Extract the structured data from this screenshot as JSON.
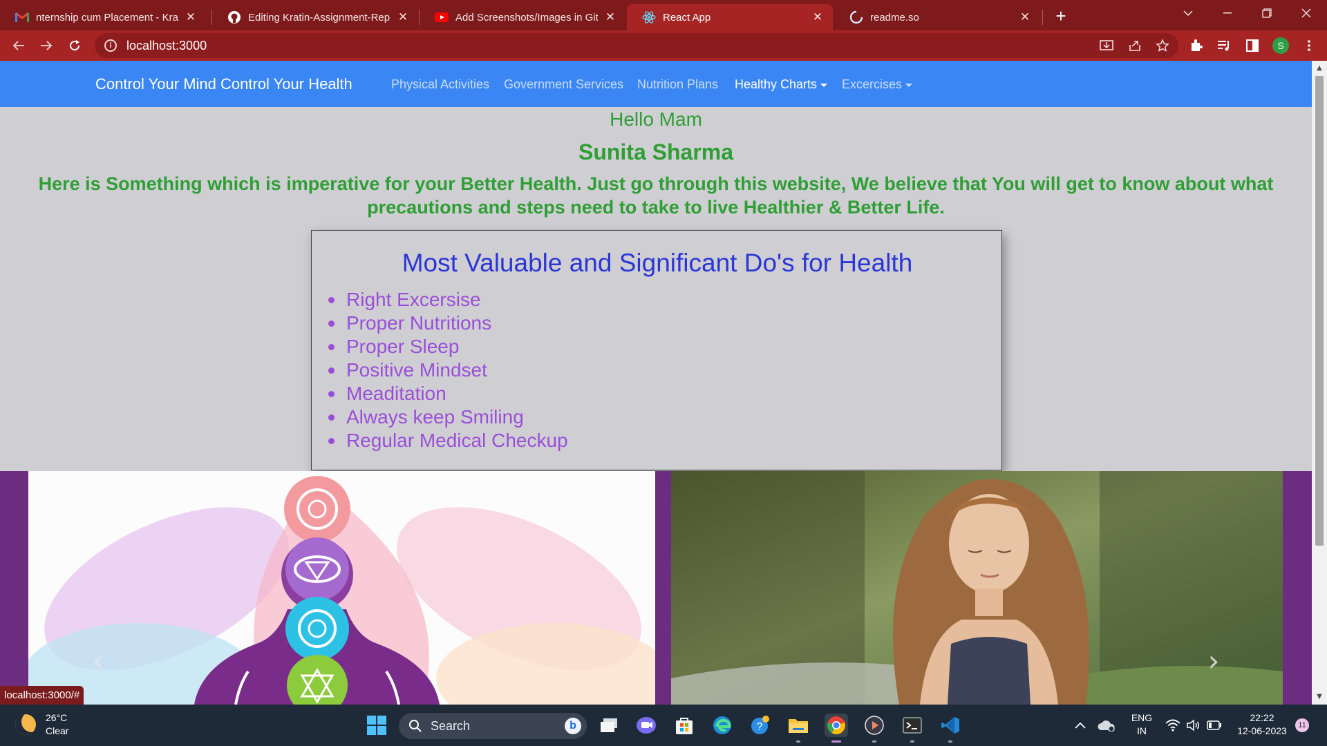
{
  "browser": {
    "tabs": [
      {
        "title": "nternship cum Placement - Kratin",
        "icon": "gmail-icon"
      },
      {
        "title": "Editing Kratin-Assignment-Repo/",
        "icon": "github-icon"
      },
      {
        "title": "Add Screenshots/Images in Githu",
        "icon": "youtube-icon"
      },
      {
        "title": "React App",
        "icon": "react-icon",
        "active": true
      },
      {
        "title": "readme.so",
        "icon": "loading-icon"
      }
    ],
    "url": "localhost:3000",
    "profile_initial": "S",
    "status_url": "localhost:3000/#"
  },
  "navbar": {
    "brand": "Control Your Mind Control Your Health",
    "links": {
      "physical": "Physical Activities",
      "government": "Government Services",
      "nutrition": "Nutrition Plans",
      "charts": "Healthy Charts",
      "exercises": "Excercises"
    }
  },
  "greeting": {
    "hello": "Hello Mam",
    "name": "Sunita Sharma",
    "message": "Here is Something which is imperative for your Better Health. Just go through this website, We believe that You will get to know about what precautions and steps need to take to live Healthier & Better Life."
  },
  "card": {
    "title": "Most Valuable and Significant Do's for Health",
    "items": [
      "Right Excersise",
      "Proper Nutritions",
      "Proper Sleep",
      "Positive Mindset",
      "Meaditation",
      "Always keep Smiling",
      "Regular Medical Checkup"
    ]
  },
  "carousel": {
    "prev": "‹",
    "next": "›"
  },
  "taskbar": {
    "weather": {
      "temp": "26°C",
      "condition": "Clear"
    },
    "search_placeholder": "Search",
    "lang": {
      "line1": "ENG",
      "line2": "IN"
    },
    "clock": {
      "time": "22:22",
      "date": "12-06-2023"
    },
    "notifications": "11"
  },
  "colors": {
    "navbar": "#3a86f5",
    "greeting": "#2f9e35",
    "card_title": "#2c36d6",
    "card_items": "#9a4ed8",
    "chrome_frame": "#7e1a1c",
    "chrome_toolbar": "#a72424"
  }
}
